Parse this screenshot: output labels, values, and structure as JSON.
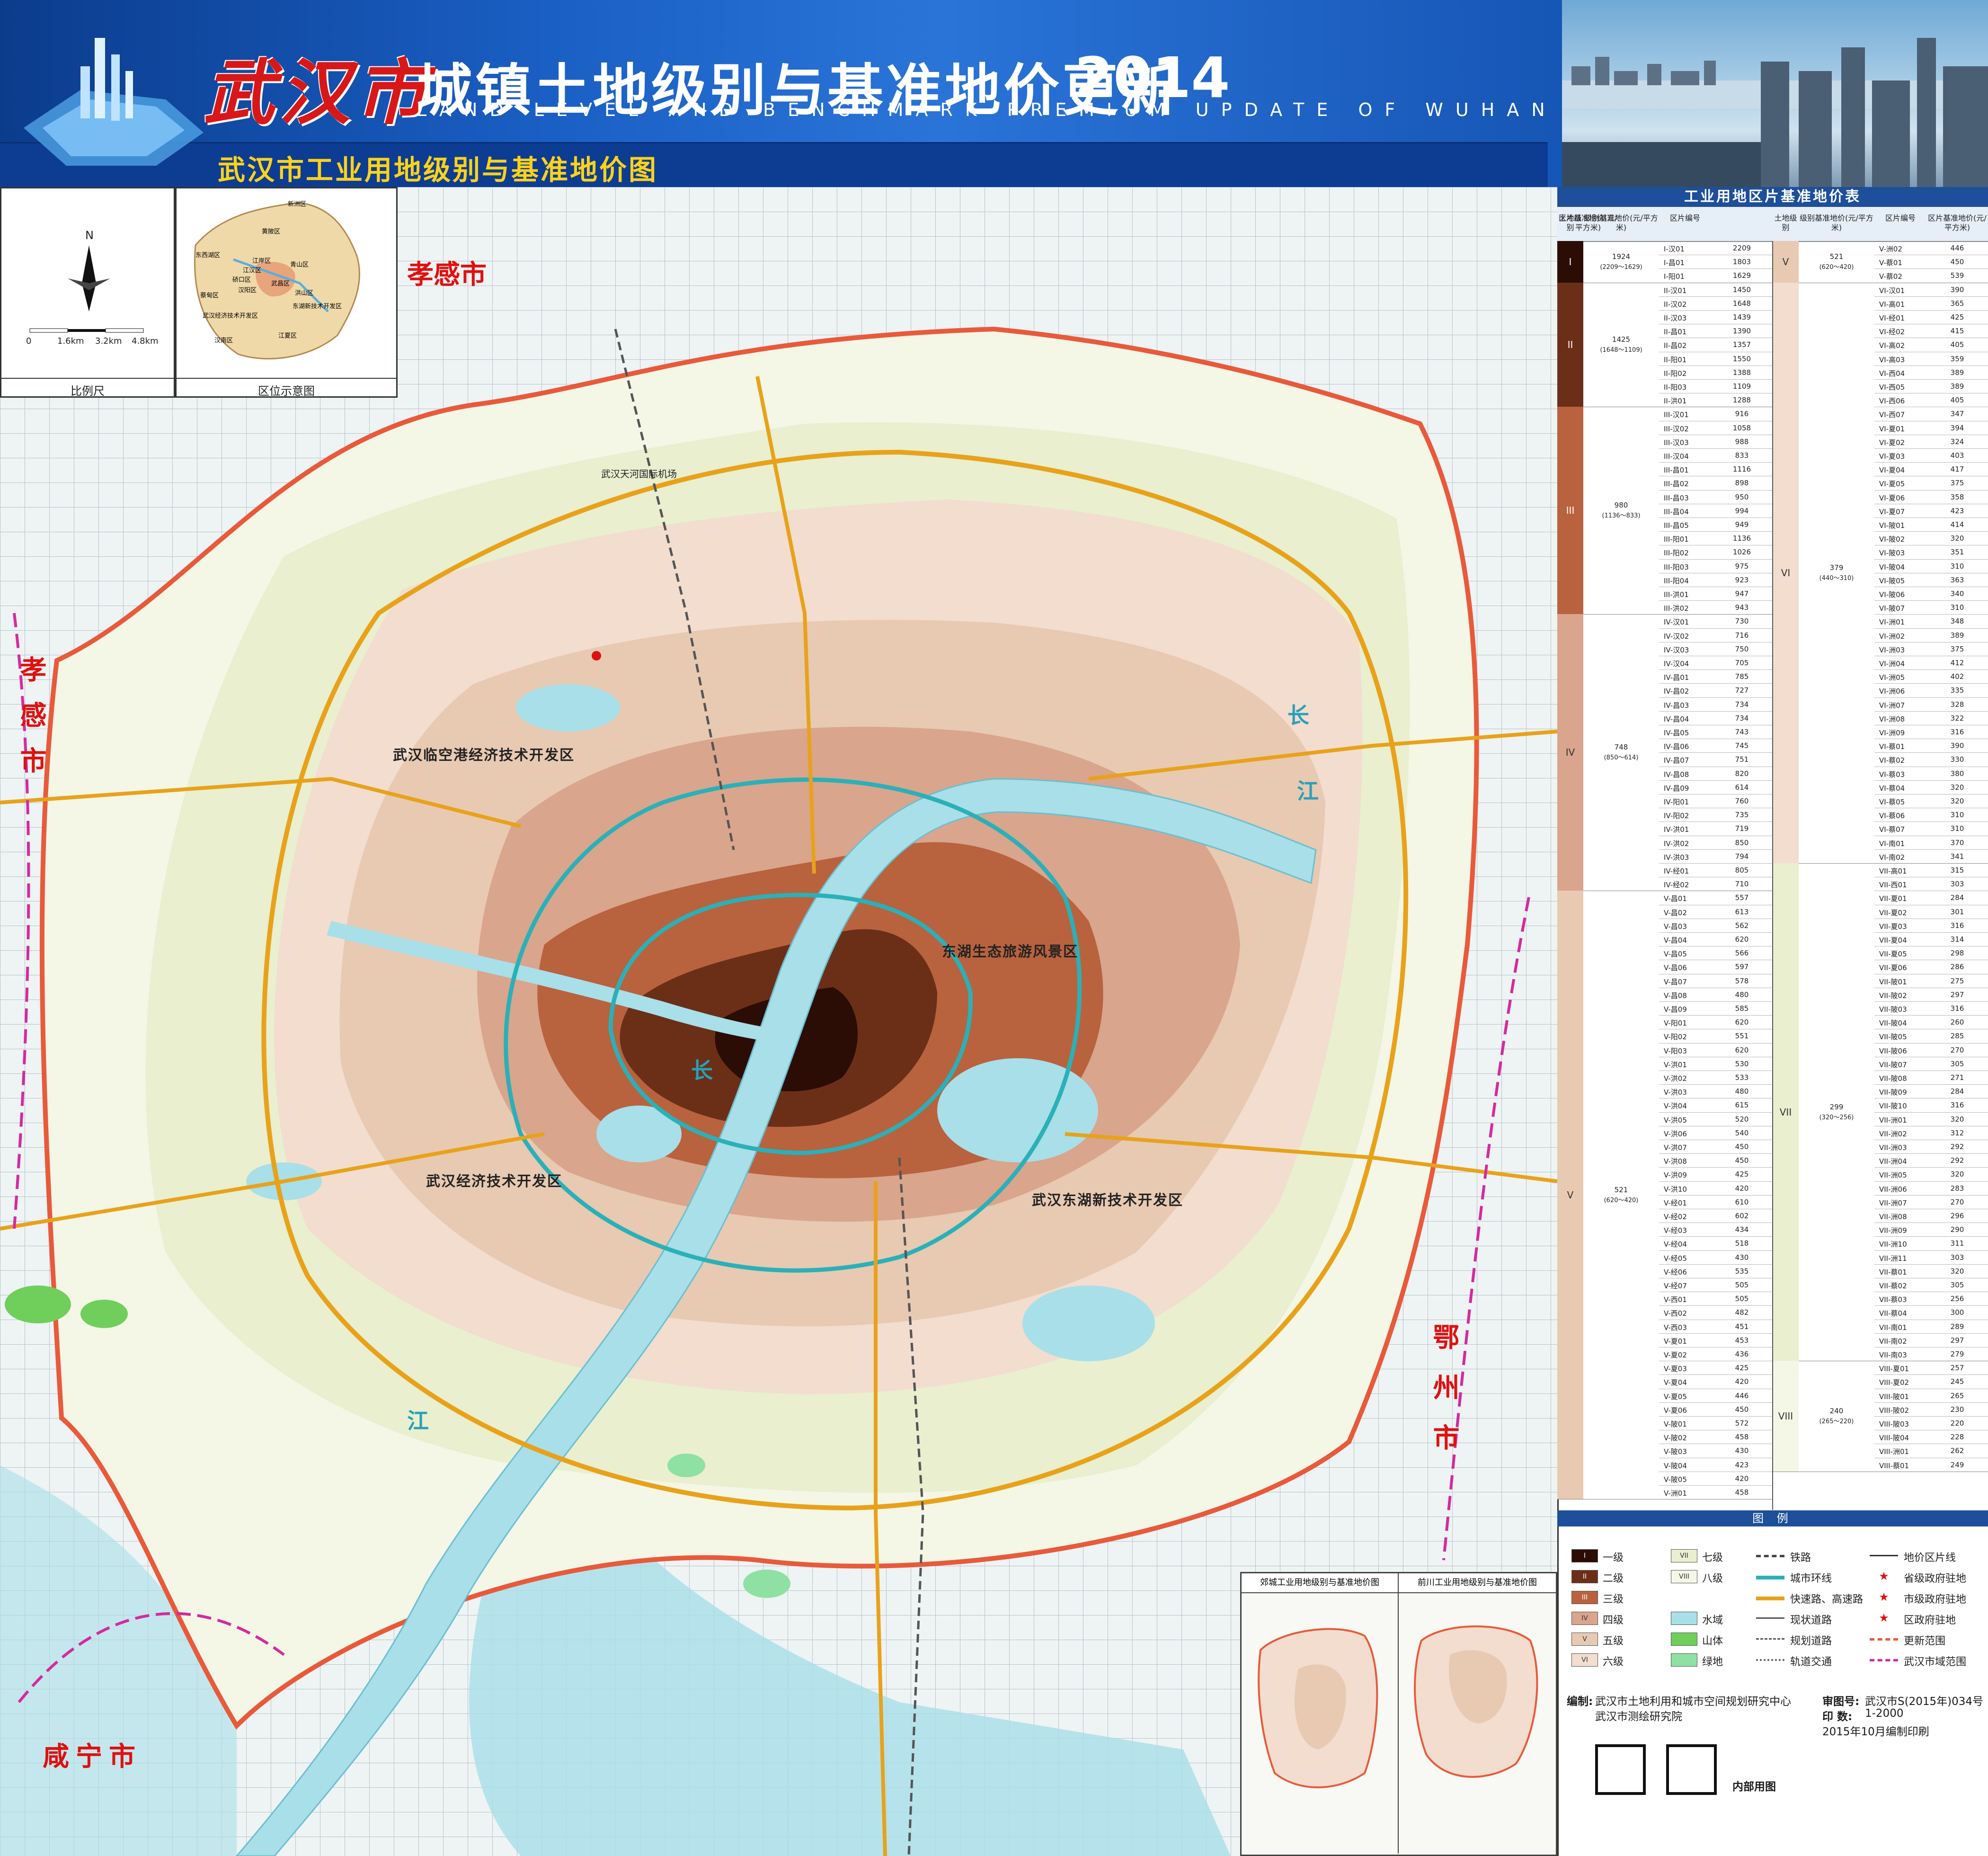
{
  "header": {
    "title_city": "武汉市",
    "title_main": "城镇土地级别与基准地价更新",
    "title_year": "2014",
    "title_en": "LAND LEVEL AND BENCHMARK PREMIUM UPDATE OF WUHAN",
    "subtitle": "武汉市工业用地级别与基准地价图"
  },
  "colors": {
    "header_blue": "#1a5fc4",
    "level_1": "#2b0d06",
    "level_2": "#6b2f18",
    "level_3": "#b9623e",
    "level_4": "#d9a58c",
    "level_5": "#e8c9b2",
    "level_6": "#f2ddcf",
    "level_7": "#e9efcf",
    "level_8": "#f4f6e6",
    "water": "#a8dfe8",
    "mountain": "#6fcf5a",
    "greenland": "#8fe0a3",
    "ring_line": "#2bb0b8",
    "expressway": "#e8a21a",
    "boundary": "#e85a3a"
  },
  "scale_box": {
    "north": "N",
    "ticks": [
      "0",
      "1.6km",
      "3.2km",
      "4.8km"
    ],
    "caption": "比例尺"
  },
  "location_box": {
    "caption": "区位示意图",
    "districts": [
      "新洲区",
      "黄陂区",
      "东西湖区",
      "江岸区",
      "江汉区",
      "硚口区",
      "青山区",
      "汉阳区",
      "武昌区",
      "洪山区",
      "东湖新技术开发区",
      "武汉经济技术开发区",
      "汉南区",
      "江夏区",
      "蔡甸区"
    ]
  },
  "map": {
    "outer_cities": [
      "孝感市",
      "孝感市",
      "鄂州市",
      "咸宁市"
    ],
    "river_chars": [
      "长",
      "江",
      "长",
      "江"
    ],
    "zones": [
      "武汉临空港经济技术开发区",
      "武汉经济技术开发区",
      "武汉东湖新技术开发区",
      "东湖生态旅游风景区"
    ],
    "labels": [
      "武汉天河国际机场"
    ]
  },
  "table": {
    "title": "工业用地区片基准地价表",
    "headers": [
      "土地级别",
      "级别基准地价(元/平方米)",
      "区片编号",
      "区片基准地价(元/平方米)"
    ],
    "left_levels": [
      {
        "level": "I",
        "avg": "1924",
        "range": "(2209～1629)",
        "rows": [
          [
            "I-汉01",
            "2209"
          ],
          [
            "I-昌01",
            "1803"
          ],
          [
            "I-阳01",
            "1629"
          ]
        ]
      },
      {
        "level": "II",
        "avg": "1425",
        "range": "(1648～1109)",
        "rows": [
          [
            "II-汉01",
            "1450"
          ],
          [
            "II-汉02",
            "1648"
          ],
          [
            "II-汉03",
            "1439"
          ],
          [
            "II-昌01",
            "1390"
          ],
          [
            "II-昌02",
            "1357"
          ],
          [
            "II-阳01",
            "1550"
          ],
          [
            "II-阳02",
            "1388"
          ],
          [
            "II-阳03",
            "1109"
          ],
          [
            "II-洪01",
            "1288"
          ]
        ]
      },
      {
        "level": "III",
        "avg": "980",
        "range": "(1136～833)",
        "rows": [
          [
            "III-汉01",
            "916"
          ],
          [
            "III-汉02",
            "1058"
          ],
          [
            "III-汉03",
            "988"
          ],
          [
            "III-汉04",
            "833"
          ],
          [
            "III-昌01",
            "1116"
          ],
          [
            "III-昌02",
            "898"
          ],
          [
            "III-昌03",
            "950"
          ],
          [
            "III-昌04",
            "994"
          ],
          [
            "III-昌05",
            "949"
          ],
          [
            "III-阳01",
            "1136"
          ],
          [
            "III-阳02",
            "1026"
          ],
          [
            "III-阳03",
            "975"
          ],
          [
            "III-阳04",
            "923"
          ],
          [
            "III-洪01",
            "947"
          ],
          [
            "III-洪02",
            "943"
          ]
        ]
      },
      {
        "level": "IV",
        "avg": "748",
        "range": "(850～614)",
        "rows": [
          [
            "IV-汉01",
            "730"
          ],
          [
            "IV-汉02",
            "716"
          ],
          [
            "IV-汉03",
            "750"
          ],
          [
            "IV-汉04",
            "705"
          ],
          [
            "IV-昌01",
            "785"
          ],
          [
            "IV-昌02",
            "727"
          ],
          [
            "IV-昌03",
            "734"
          ],
          [
            "IV-昌04",
            "734"
          ],
          [
            "IV-昌05",
            "743"
          ],
          [
            "IV-昌06",
            "745"
          ],
          [
            "IV-昌07",
            "751"
          ],
          [
            "IV-昌08",
            "820"
          ],
          [
            "IV-昌09",
            "614"
          ],
          [
            "IV-阳01",
            "760"
          ],
          [
            "IV-阳02",
            "735"
          ],
          [
            "IV-洪01",
            "719"
          ],
          [
            "IV-洪02",
            "850"
          ],
          [
            "IV-洪03",
            "794"
          ],
          [
            "IV-经01",
            "805"
          ],
          [
            "IV-经02",
            "710"
          ]
        ]
      },
      {
        "level": "V",
        "avg": "521",
        "range": "(620～420)",
        "rows": [
          [
            "V-昌01",
            "557"
          ],
          [
            "V-昌02",
            "613"
          ],
          [
            "V-昌03",
            "562"
          ],
          [
            "V-昌04",
            "620"
          ],
          [
            "V-昌05",
            "566"
          ],
          [
            "V-昌06",
            "597"
          ],
          [
            "V-昌07",
            "578"
          ],
          [
            "V-昌08",
            "480"
          ],
          [
            "V-昌09",
            "585"
          ],
          [
            "V-阳01",
            "620"
          ],
          [
            "V-阳02",
            "551"
          ],
          [
            "V-阳03",
            "620"
          ],
          [
            "V-洪01",
            "530"
          ],
          [
            "V-洪02",
            "533"
          ],
          [
            "V-洪03",
            "480"
          ],
          [
            "V-洪04",
            "615"
          ],
          [
            "V-洪05",
            "520"
          ],
          [
            "V-洪06",
            "540"
          ],
          [
            "V-洪07",
            "450"
          ],
          [
            "V-洪08",
            "450"
          ],
          [
            "V-洪09",
            "425"
          ],
          [
            "V-洪10",
            "420"
          ],
          [
            "V-经01",
            "610"
          ],
          [
            "V-经02",
            "602"
          ],
          [
            "V-经03",
            "434"
          ],
          [
            "V-经04",
            "518"
          ],
          [
            "V-经05",
            "430"
          ],
          [
            "V-经06",
            "535"
          ],
          [
            "V-经07",
            "505"
          ],
          [
            "V-西01",
            "505"
          ],
          [
            "V-西02",
            "482"
          ],
          [
            "V-西03",
            "451"
          ],
          [
            "V-夏01",
            "453"
          ],
          [
            "V-夏02",
            "436"
          ],
          [
            "V-夏03",
            "425"
          ],
          [
            "V-夏04",
            "420"
          ],
          [
            "V-夏05",
            "446"
          ],
          [
            "V-夏06",
            "450"
          ],
          [
            "V-陂01",
            "572"
          ],
          [
            "V-陂02",
            "458"
          ],
          [
            "V-陂03",
            "430"
          ],
          [
            "V-陂04",
            "423"
          ],
          [
            "V-陂05",
            "420"
          ],
          [
            "V-洲01",
            "458"
          ]
        ]
      }
    ],
    "right_levels": [
      {
        "level": "V",
        "avg": "521",
        "range": "(620～420)",
        "rows": [
          [
            "V-洲02",
            "446"
          ],
          [
            "V-蔡01",
            "450"
          ],
          [
            "V-蔡02",
            "539"
          ]
        ]
      },
      {
        "level": "VI",
        "avg": "379",
        "range": "(440～310)",
        "rows": [
          [
            "VI-汉01",
            "390"
          ],
          [
            "VI-高01",
            "365"
          ],
          [
            "VI-经01",
            "425"
          ],
          [
            "VI-经02",
            "415"
          ],
          [
            "VI-高02",
            "405"
          ],
          [
            "VI-高03",
            "359"
          ],
          [
            "VI-西04",
            "389"
          ],
          [
            "VI-西05",
            "389"
          ],
          [
            "VI-西06",
            "405"
          ],
          [
            "VI-西07",
            "347"
          ],
          [
            "VI-夏01",
            "394"
          ],
          [
            "VI-夏02",
            "324"
          ],
          [
            "VI-夏03",
            "403"
          ],
          [
            "VI-夏04",
            "417"
          ],
          [
            "VI-夏05",
            "375"
          ],
          [
            "VI-夏06",
            "358"
          ],
          [
            "VI-夏07",
            "423"
          ],
          [
            "VI-陂01",
            "414"
          ],
          [
            "VI-陂02",
            "320"
          ],
          [
            "VI-陂03",
            "351"
          ],
          [
            "VI-陂04",
            "310"
          ],
          [
            "VI-陂05",
            "363"
          ],
          [
            "VI-陂06",
            "340"
          ],
          [
            "VI-陂07",
            "310"
          ],
          [
            "VI-洲01",
            "348"
          ],
          [
            "VI-洲02",
            "389"
          ],
          [
            "VI-洲03",
            "375"
          ],
          [
            "VI-洲04",
            "412"
          ],
          [
            "VI-洲05",
            "402"
          ],
          [
            "VI-洲06",
            "335"
          ],
          [
            "VI-洲07",
            "328"
          ],
          [
            "VI-洲08",
            "322"
          ],
          [
            "VI-洲09",
            "316"
          ],
          [
            "VI-蔡01",
            "390"
          ],
          [
            "VI-蔡02",
            "330"
          ],
          [
            "VI-蔡03",
            "380"
          ],
          [
            "VI-蔡04",
            "320"
          ],
          [
            "VI-蔡05",
            "320"
          ],
          [
            "VI-蔡06",
            "310"
          ],
          [
            "VI-蔡07",
            "310"
          ],
          [
            "VI-南01",
            "370"
          ],
          [
            "VI-南02",
            "341"
          ]
        ]
      },
      {
        "level": "VII",
        "avg": "299",
        "range": "(320～256)",
        "rows": [
          [
            "VII-高01",
            "315"
          ],
          [
            "VII-西01",
            "303"
          ],
          [
            "VII-夏01",
            "284"
          ],
          [
            "VII-夏02",
            "301"
          ],
          [
            "VII-夏03",
            "316"
          ],
          [
            "VII-夏04",
            "314"
          ],
          [
            "VII-夏05",
            "298"
          ],
          [
            "VII-夏06",
            "286"
          ],
          [
            "VII-陂01",
            "275"
          ],
          [
            "VII-陂02",
            "297"
          ],
          [
            "VII-陂03",
            "316"
          ],
          [
            "VII-陂04",
            "260"
          ],
          [
            "VII-陂05",
            "285"
          ],
          [
            "VII-陂06",
            "270"
          ],
          [
            "VII-陂07",
            "305"
          ],
          [
            "VII-陂08",
            "271"
          ],
          [
            "VII-陂09",
            "284"
          ],
          [
            "VII-陂10",
            "316"
          ],
          [
            "VII-洲01",
            "320"
          ],
          [
            "VII-洲02",
            "312"
          ],
          [
            "VII-洲03",
            "292"
          ],
          [
            "VII-洲04",
            "292"
          ],
          [
            "VII-洲05",
            "320"
          ],
          [
            "VII-洲06",
            "283"
          ],
          [
            "VII-洲07",
            "270"
          ],
          [
            "VII-洲08",
            "296"
          ],
          [
            "VII-洲09",
            "290"
          ],
          [
            "VII-洲10",
            "311"
          ],
          [
            "VII-洲11",
            "303"
          ],
          [
            "VII-蔡01",
            "320"
          ],
          [
            "VII-蔡02",
            "305"
          ],
          [
            "VII-蔡03",
            "256"
          ],
          [
            "VII-蔡04",
            "300"
          ],
          [
            "VII-南01",
            "289"
          ],
          [
            "VII-南02",
            "297"
          ],
          [
            "VII-南03",
            "279"
          ]
        ]
      },
      {
        "level": "VIII",
        "avg": "240",
        "range": "(265～220)",
        "rows": [
          [
            "VIII-夏01",
            "257"
          ],
          [
            "VIII-夏02",
            "245"
          ],
          [
            "VIII-陂01",
            "265"
          ],
          [
            "VIII-陂02",
            "230"
          ],
          [
            "VIII-陂03",
            "220"
          ],
          [
            "VIII-陂04",
            "228"
          ],
          [
            "VIII-洲01",
            "262"
          ],
          [
            "VIII-蔡01",
            "249"
          ]
        ]
      }
    ]
  },
  "legend": {
    "title": "图 例",
    "levels": [
      [
        "I",
        "一级"
      ],
      [
        "II",
        "二级"
      ],
      [
        "III",
        "三级"
      ],
      [
        "IV",
        "四级"
      ],
      [
        "V",
        "五级"
      ],
      [
        "VI",
        "六级"
      ],
      [
        "VII",
        "七级"
      ],
      [
        "VIII",
        "八级"
      ]
    ],
    "land_types": [
      "水域",
      "山体",
      "绿地"
    ],
    "lines": [
      "铁路",
      "城市环线",
      "快速路、高速路",
      "现状道路",
      "规划道路",
      "轨道交通"
    ],
    "symbols": [
      "地价区片线",
      "省级政府驻地",
      "市级政府驻地",
      "区政府驻地",
      "更新范围",
      "武汉市域范围"
    ]
  },
  "insets": {
    "left_title": "郊城工业用地级别与基准地价图",
    "right_title": "前川工业用地级别与基准地价图"
  },
  "footer": {
    "compiler_label": "编制:",
    "compiler_1": "武汉市土地利用和城市空间规划研究中心",
    "compiler_2": "武汉市测绘研究院",
    "review_label": "审图号:",
    "review_no": "武汉市S(2015年)034号",
    "print_label": "印 数:",
    "print_count": "1-2000",
    "date": "2015年10月编制印刷",
    "internal": "内部用图"
  }
}
